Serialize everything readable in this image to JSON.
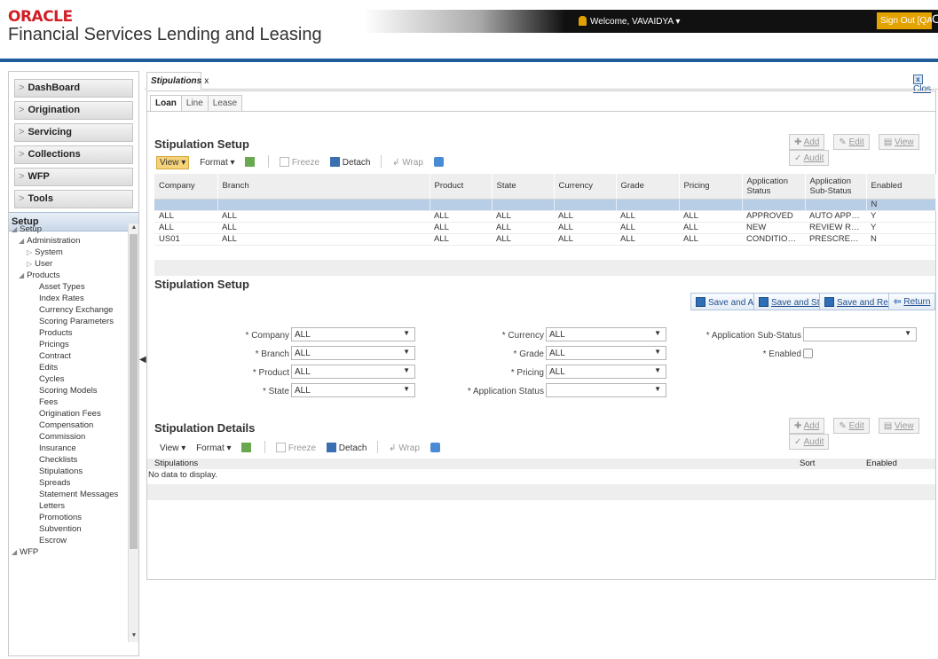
{
  "header": {
    "brand": "ORACLE",
    "product": "Financial Services Lending and Leasing",
    "welcome": "Welcome, VAVAIDYA ▾",
    "sign_out": "Sign Out [QA"
  },
  "sidebar": {
    "nav": [
      "DashBoard",
      "Origination",
      "Servicing",
      "Collections",
      "WFP",
      "Tools"
    ],
    "setup_label": "Setup",
    "tree": [
      {
        "label": "Setup",
        "level": 0,
        "expander": "◢"
      },
      {
        "label": "Administration",
        "level": 1,
        "expander": "◢"
      },
      {
        "label": "System",
        "level": 2,
        "expander": "▷"
      },
      {
        "label": "User",
        "level": 2,
        "expander": "▷"
      },
      {
        "label": "Products",
        "level": 1,
        "expander": "◢"
      },
      {
        "label": "Asset Types",
        "level": 3
      },
      {
        "label": "Index Rates",
        "level": 3
      },
      {
        "label": "Currency Exchange",
        "level": 3
      },
      {
        "label": "Scoring Parameters",
        "level": 3
      },
      {
        "label": "Products",
        "level": 3
      },
      {
        "label": "Pricings",
        "level": 3
      },
      {
        "label": "Contract",
        "level": 3
      },
      {
        "label": "Edits",
        "level": 3
      },
      {
        "label": "Cycles",
        "level": 3
      },
      {
        "label": "Scoring Models",
        "level": 3
      },
      {
        "label": "Fees",
        "level": 3
      },
      {
        "label": "Origination Fees",
        "level": 3
      },
      {
        "label": "Compensation",
        "level": 3
      },
      {
        "label": "Commission",
        "level": 3
      },
      {
        "label": "Insurance",
        "level": 3
      },
      {
        "label": "Checklists",
        "level": 3
      },
      {
        "label": "Stipulations",
        "level": 3
      },
      {
        "label": "Spreads",
        "level": 3
      },
      {
        "label": "Statement Messages",
        "level": 3
      },
      {
        "label": "Letters",
        "level": 3
      },
      {
        "label": "Promotions",
        "level": 3
      },
      {
        "label": "Subvention",
        "level": 3
      },
      {
        "label": "Escrow",
        "level": 3
      },
      {
        "label": "WFP",
        "level": 0,
        "expander": "◢"
      }
    ]
  },
  "main": {
    "tab_label": "Stipulations",
    "tab_close": "x",
    "close_label": "Clos",
    "subtabs": [
      "Loan",
      "Line",
      "Lease"
    ],
    "setup_title": "Stipulation Setup",
    "form_title": "Stipulation Setup",
    "details_title": "Stipulation Details",
    "actions": {
      "add": "Add",
      "edit": "Edit",
      "view": "View",
      "audit": "Audit"
    },
    "toolbar": {
      "view": "View ▾",
      "format": "Format ▾",
      "freeze": "Freeze",
      "detach": "Detach",
      "wrap": "Wrap"
    },
    "table": {
      "columns": [
        "Company",
        "Branch",
        "Product",
        "State",
        "Currency",
        "Grade",
        "Pricing",
        "Application Status",
        "Application Sub-Status",
        "Enabled"
      ],
      "rows": [
        [
          "",
          "",
          "",
          "",
          "",
          "",
          "",
          "",
          "",
          "N"
        ],
        [
          "ALL",
          "ALL",
          "ALL",
          "ALL",
          "ALL",
          "ALL",
          "ALL",
          "APPROVED",
          "AUTO APPROVED",
          "Y"
        ],
        [
          "ALL",
          "ALL",
          "ALL",
          "ALL",
          "ALL",
          "ALL",
          "ALL",
          "NEW",
          "REVIEW REQUIRED",
          "Y"
        ],
        [
          "US01",
          "ALL",
          "ALL",
          "ALL",
          "ALL",
          "ALL",
          "ALL",
          "CONDITIONED",
          "PRESCREEN APPR...",
          "N"
        ]
      ]
    },
    "form_buttons": {
      "save_add": "Save and Add",
      "save_stay": "Save and Stay",
      "save_return": "Save and Return",
      "return": "Return"
    },
    "form": {
      "company": {
        "label": "* Company",
        "value": "ALL"
      },
      "branch": {
        "label": "* Branch",
        "value": "ALL"
      },
      "product": {
        "label": "* Product",
        "value": "ALL"
      },
      "state": {
        "label": "* State",
        "value": "ALL"
      },
      "currency": {
        "label": "* Currency",
        "value": "ALL"
      },
      "grade": {
        "label": "* Grade",
        "value": "ALL"
      },
      "pricing": {
        "label": "* Pricing",
        "value": "ALL"
      },
      "app_status": {
        "label": "* Application Status",
        "value": ""
      },
      "app_sub_status": {
        "label": "* Application Sub-Status",
        "value": ""
      },
      "enabled": {
        "label": "* Enabled",
        "checked": false
      }
    },
    "details": {
      "columns": [
        "Stipulations",
        "Sort",
        "Enabled"
      ],
      "empty": "No data to display."
    }
  }
}
